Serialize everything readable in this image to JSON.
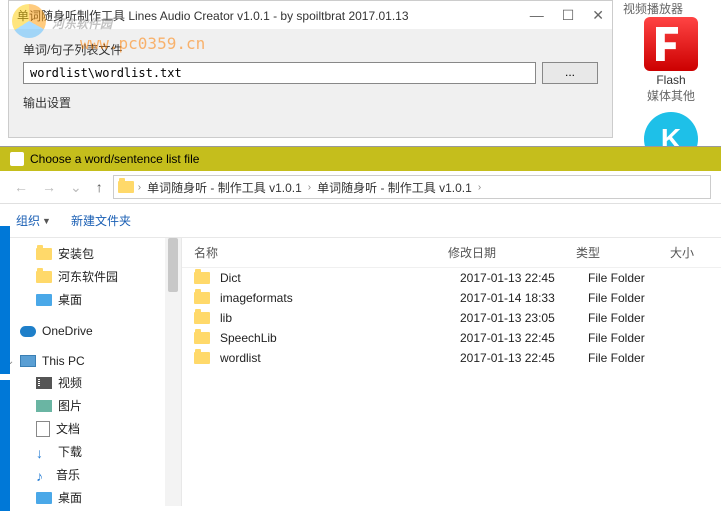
{
  "bgApp": {
    "title": "单词随身听制作工具  Lines Audio Creator v1.0.1 - by spoiltbrat  2017.01.13",
    "minimize": "—",
    "maximize": "☐",
    "close": "✕",
    "label1": "单词/句子列表文件",
    "inputValue": "wordlist\\wordlist.txt",
    "browse": "...",
    "label2": "输出设置"
  },
  "watermark": {
    "text": "河东软件园",
    "url": "www.pc0359.cn"
  },
  "desktop": {
    "topText": "视频播放器",
    "flashLabel": "Flash",
    "flashSub": "媒体其他",
    "k": "K"
  },
  "dialog": {
    "title": "Choose a word/sentence list file",
    "back": "←",
    "fwd": "→",
    "dropdown": "⌄",
    "up": "↑",
    "addrSeg1": "单词随身听 - 制作工具 v1.0.1",
    "addrSeg2": "单词随身听 - 制作工具 v1.0.1",
    "arrow": "›",
    "organize": "组织",
    "newFolder": "新建文件夹",
    "tree": {
      "t1": "安装包",
      "t2": "河东软件园",
      "t3": "桌面",
      "t4": "OneDrive",
      "t5": "This PC",
      "t6": "视频",
      "t7": "图片",
      "t8": "文档",
      "t9": "下载",
      "t10": "音乐",
      "t11": "桌面"
    },
    "headers": {
      "name": "名称",
      "date": "修改日期",
      "type": "类型",
      "size": "大小"
    },
    "files": [
      {
        "name": "Dict",
        "date": "2017-01-13 22:45",
        "type": "File Folder"
      },
      {
        "name": "imageformats",
        "date": "2017-01-14 18:33",
        "type": "File Folder"
      },
      {
        "name": "lib",
        "date": "2017-01-13 23:05",
        "type": "File Folder"
      },
      {
        "name": "SpeechLib",
        "date": "2017-01-13 22:45",
        "type": "File Folder"
      },
      {
        "name": "wordlist",
        "date": "2017-01-13 22:45",
        "type": "File Folder"
      }
    ]
  }
}
